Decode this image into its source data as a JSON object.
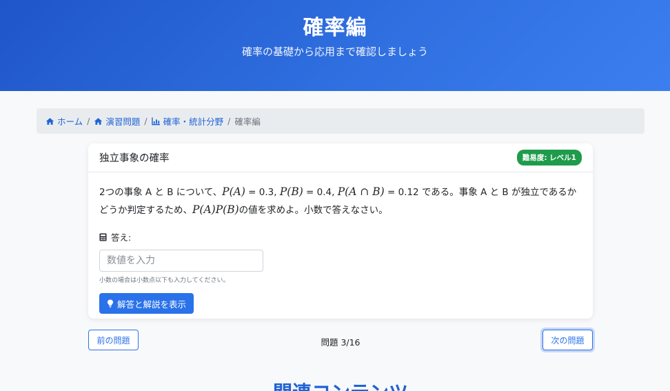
{
  "header": {
    "title": "確率編",
    "subtitle": "確率の基礎から応用まで確認しましょう"
  },
  "breadcrumb": {
    "items": [
      {
        "label": "ホーム",
        "icon": "home-icon"
      },
      {
        "label": "演習問題",
        "icon": "home-icon"
      },
      {
        "label": "確率・統計分野",
        "icon": "chart-icon"
      }
    ],
    "current": "確率編",
    "separator": "/"
  },
  "card": {
    "title": "独立事象の確率",
    "badge": "難易度: レベル1",
    "question": {
      "part1": "2つの事象 A と B について、",
      "pa": "P(A)",
      "eq1": " = 0.3, ",
      "pb": "P(B)",
      "eq2": " = 0.4, ",
      "pab": "P(A ∩ B)",
      "eq3": " = 0.12 である。事象 A と B が独立であるかどうか判定するため、",
      "papb": "P(A)P(B)",
      "part2": "の値を求めよ。小数で答えなさい。"
    },
    "answer_label": "答え:",
    "input_placeholder": "数値を入力",
    "hint": "小数の場合は小数点以下も入力してください。",
    "show_button": "解答と解説を表示"
  },
  "navigation": {
    "prev": "前の問題",
    "counter": "問題 3/16",
    "next": "次の問題"
  },
  "related_title": "関連コンテンツ",
  "colors": {
    "primary": "#2a72ea",
    "header_gradient_start": "#1f56c9",
    "badge_green": "#1f9b4c"
  }
}
